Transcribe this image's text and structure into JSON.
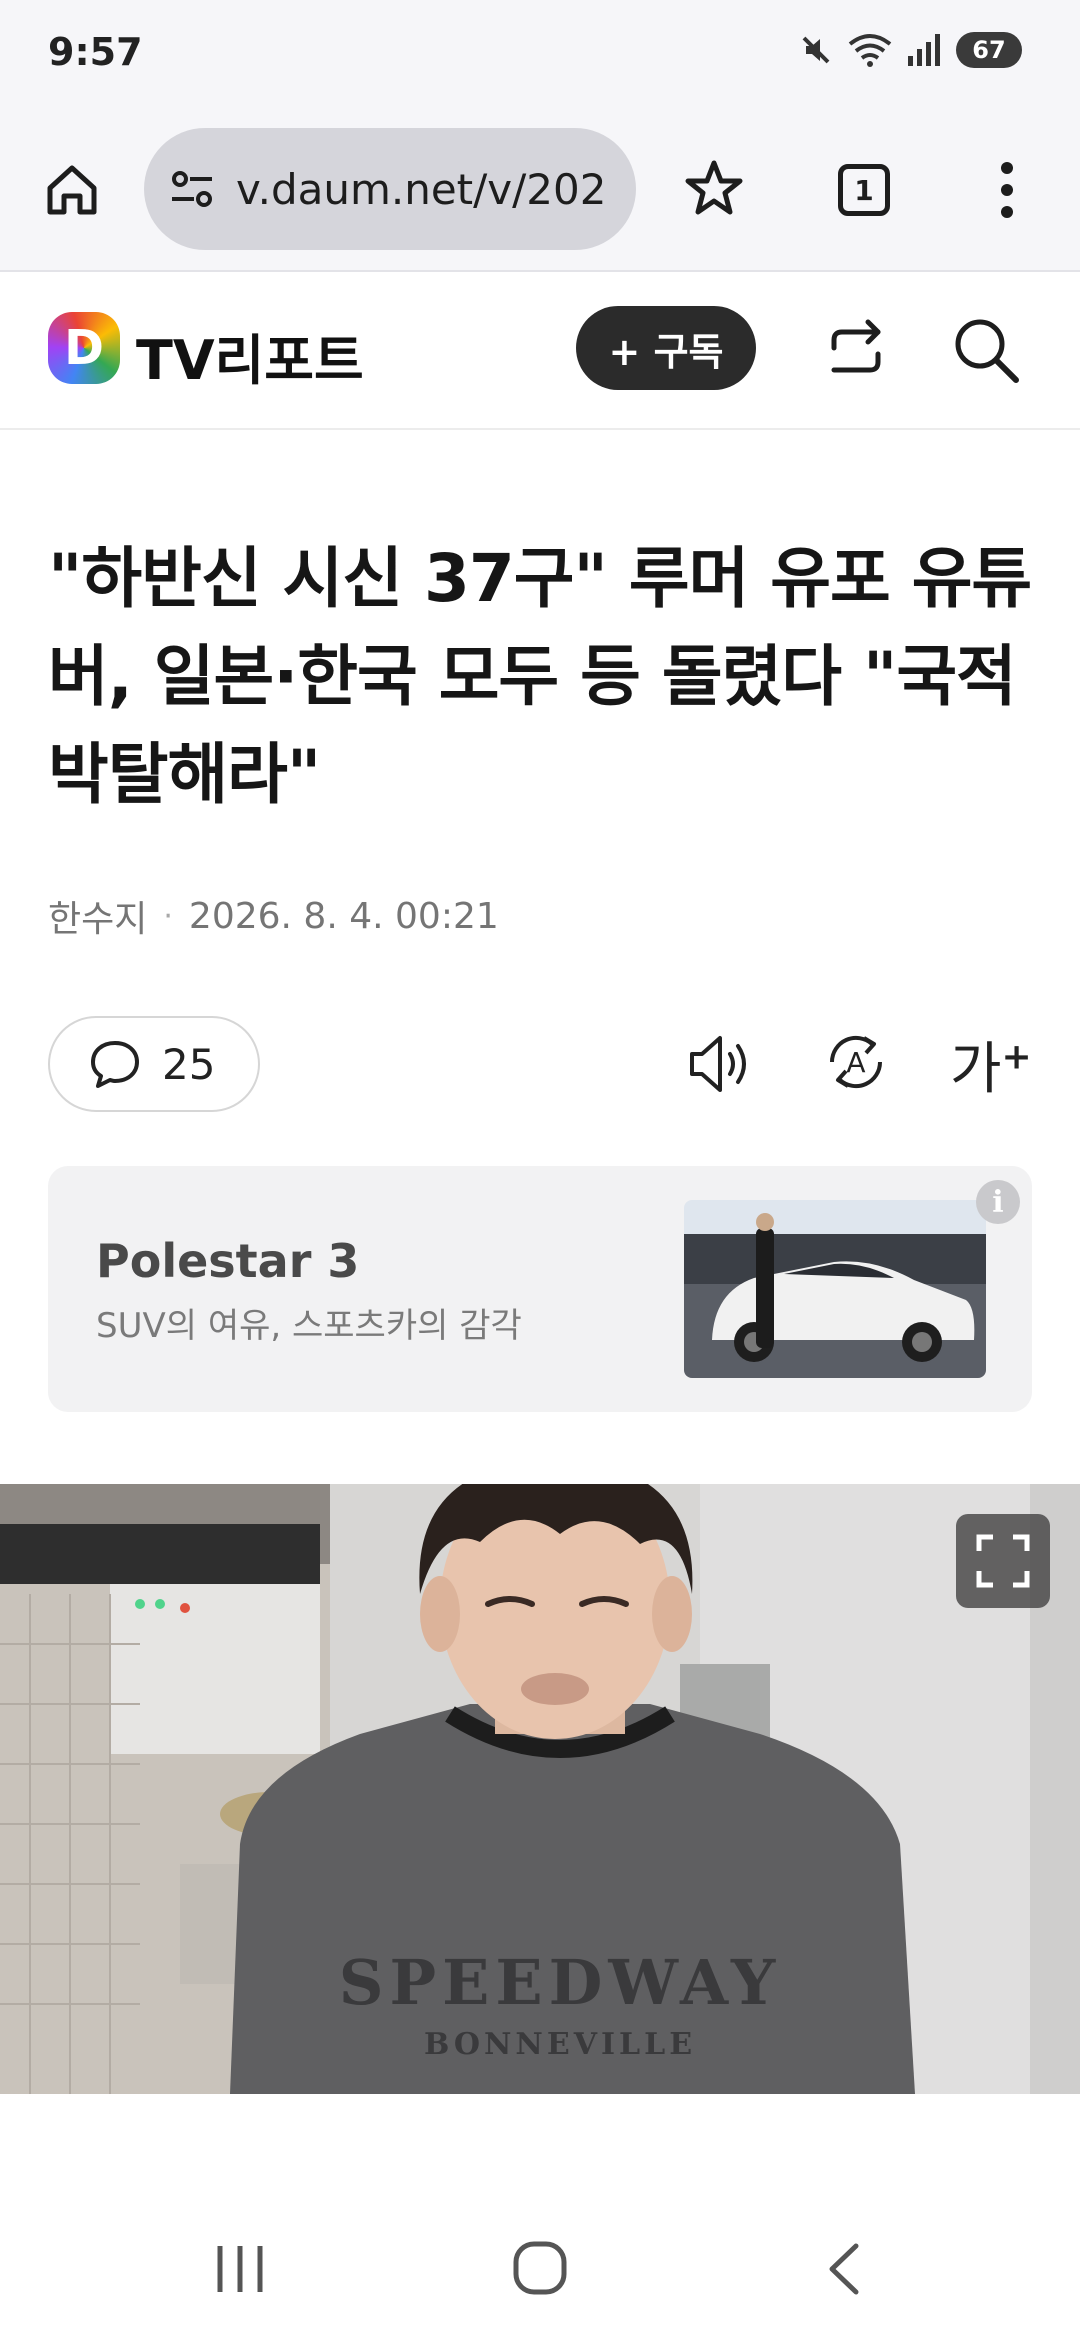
{
  "status_bar": {
    "time": "9:57",
    "battery": "67",
    "icons": [
      "mute-icon",
      "wifi-icon",
      "signal-icon",
      "battery-icon"
    ]
  },
  "browser": {
    "url": "v.daum.net/v/202",
    "tab_count": "1",
    "icons": [
      "home-icon",
      "site-settings-icon",
      "bookmark-star-icon",
      "tabs-icon",
      "more-vert-icon"
    ]
  },
  "site_header": {
    "logo_letter": "D",
    "channel_name": "TV리포트",
    "subscribe_label": "+ 구독",
    "icons": [
      "share-icon",
      "search-icon"
    ]
  },
  "article": {
    "headline": "\"하반신 시신 37구\" 루머 유포 유튜버, 일본·한국 모두 등 돌렸다 \"국적 박탈해라\"",
    "author": "한수지",
    "separator": "·",
    "datetime": "2026. 8. 4. 00:21",
    "comment_count": "25",
    "font_size_label": "가",
    "font_size_sup": "+"
  },
  "ad": {
    "title": "Polestar 3",
    "subtitle": "SUV의 여유, 스포츠카의 감각",
    "info_label": "i"
  },
  "video": {
    "shirt_text_1": "SPEEDWAY",
    "shirt_text_2": "BONNEVILLE"
  },
  "colors": {
    "chrome_bg": "#f6f6f9",
    "url_pill": "#d5d5db",
    "subscribe_bg": "#2b2b2b",
    "ad_bg": "#f2f2f3"
  }
}
